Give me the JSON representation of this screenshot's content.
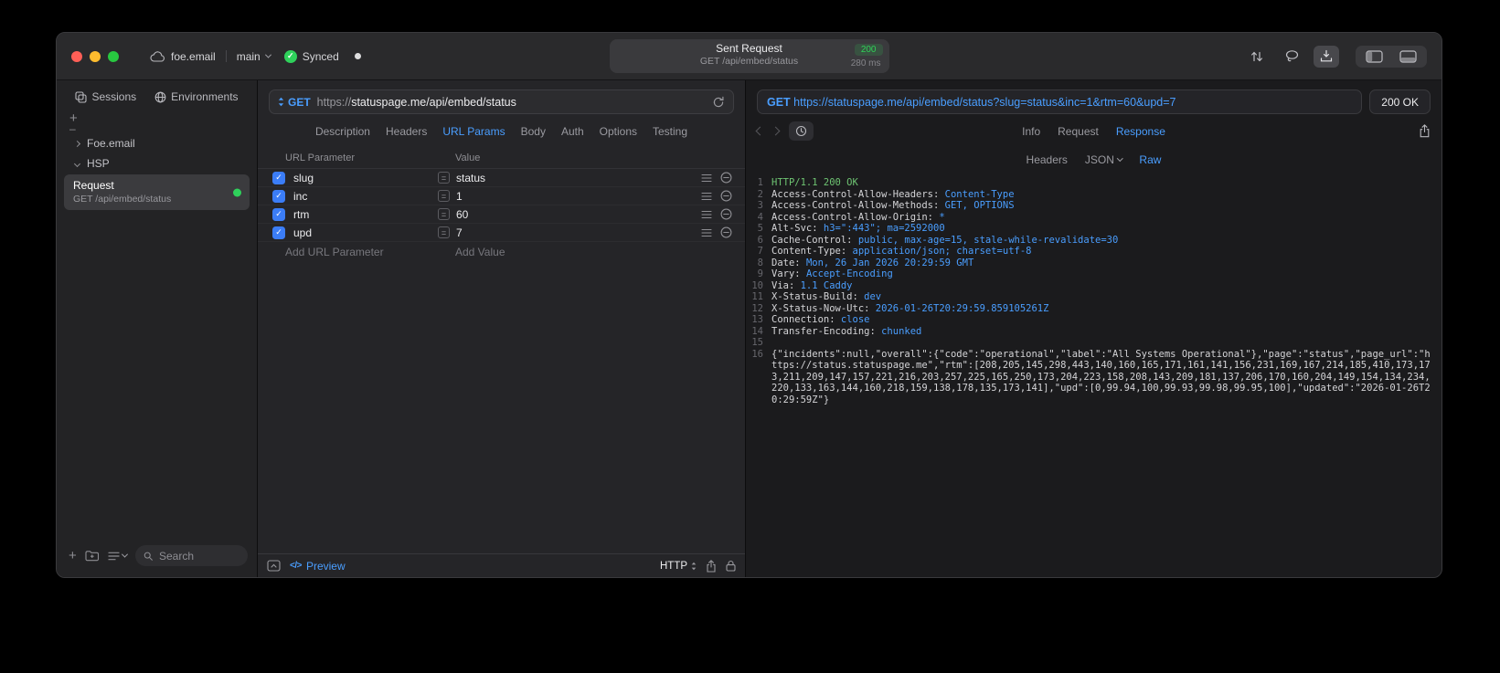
{
  "titlebar": {
    "project": "foe.email",
    "branch": "main",
    "sync_status": "Synced",
    "request_summary": {
      "title": "Sent Request",
      "status_code": "200",
      "request_line": "GET /api/embed/status",
      "duration": "280 ms"
    }
  },
  "sidebar": {
    "tabs": [
      "Sessions",
      "Environments"
    ],
    "tree": [
      {
        "label": "Foe.email",
        "expanded": false
      },
      {
        "label": "HSP",
        "expanded": true
      }
    ],
    "request_item": {
      "name": "Request",
      "method_path": "GET /api/embed/status"
    },
    "search_placeholder": "Search"
  },
  "request_pane": {
    "method": "GET",
    "url": "https://statuspage.me/api/embed/status",
    "tabs": [
      "Description",
      "Headers",
      "URL Params",
      "Body",
      "Auth",
      "Options",
      "Testing"
    ],
    "active_tab": "URL Params",
    "table": {
      "columns": [
        "URL Parameter",
        "Value"
      ],
      "rows": [
        {
          "name": "slug",
          "value": "status",
          "enabled": true
        },
        {
          "name": "inc",
          "value": "1",
          "enabled": true
        },
        {
          "name": "rtm",
          "value": "60",
          "enabled": true
        },
        {
          "name": "upd",
          "value": "7",
          "enabled": true
        }
      ],
      "add_parameter_label": "Add URL Parameter",
      "add_value_label": "Add Value"
    },
    "footer": {
      "preview_label": "Preview",
      "code_glyph": "</>",
      "protocol_label": "HTTP"
    }
  },
  "response_pane": {
    "request_line": "GET https://statuspage.me/api/embed/status?slug=status&inc=1&rtm=60&upd=7",
    "status_label": "200 OK",
    "tabs": [
      "Info",
      "Request",
      "Response"
    ],
    "active_tab": "Response",
    "subtabs": [
      {
        "label": "Headers"
      },
      {
        "label": "JSON",
        "caret": true
      },
      {
        "label": "Raw"
      }
    ],
    "active_subtab": "Raw",
    "raw": {
      "status_line": "HTTP/1.1 200 OK",
      "headers": [
        {
          "name": "Access-Control-Allow-Headers",
          "value": "Content-Type"
        },
        {
          "name": "Access-Control-Allow-Methods",
          "value": "GET, OPTIONS"
        },
        {
          "name": "Access-Control-Allow-Origin",
          "value": "*"
        },
        {
          "name": "Alt-Svc",
          "value": "h3=\":443\"; ma=2592000"
        },
        {
          "name": "Cache-Control",
          "value": "public, max-age=15, stale-while-revalidate=30"
        },
        {
          "name": "Content-Type",
          "value": "application/json; charset=utf-8"
        },
        {
          "name": "Date",
          "value": "Mon, 26 Jan 2026 20:29:59 GMT"
        },
        {
          "name": "Vary",
          "value": "Accept-Encoding"
        },
        {
          "name": "Via",
          "value": "1.1 Caddy"
        },
        {
          "name": "X-Status-Build",
          "value": "dev"
        },
        {
          "name": "X-Status-Now-Utc",
          "value": "2026-01-26T20:29:59.859105261Z"
        },
        {
          "name": "Connection",
          "value": "close"
        },
        {
          "name": "Transfer-Encoding",
          "value": "chunked"
        }
      ],
      "body": "{\"incidents\":null,\"overall\":{\"code\":\"operational\",\"label\":\"All Systems Operational\"},\"page\":\"status\",\"page_url\":\"https://status.statuspage.me\",\"rtm\":[208,205,145,298,443,140,160,165,171,161,141,156,231,169,167,214,185,410,173,173,211,209,147,157,221,216,203,257,225,165,250,173,204,223,158,208,143,209,181,137,206,170,160,204,149,154,134,234,220,133,163,144,160,218,159,138,178,135,173,141],\"upd\":[0,99.94,100,99.93,99.98,99.95,100],\"updated\":\"2026-01-26T20:29:59Z\"}"
    }
  },
  "colors": {
    "accent_blue": "#4a9eff",
    "green": "#30d158"
  }
}
